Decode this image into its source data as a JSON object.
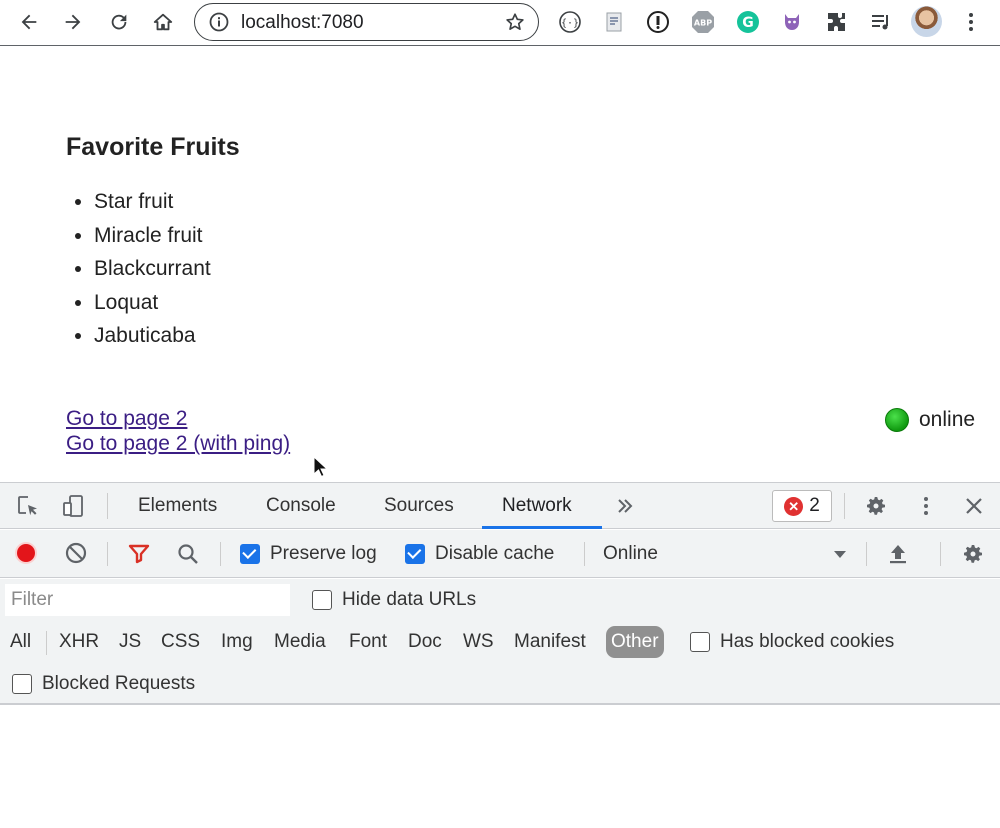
{
  "browser": {
    "url": "localhost:7080"
  },
  "page": {
    "title": "Favorite Fruits",
    "fruits": [
      "Star fruit",
      "Miracle fruit",
      "Blackcurrant",
      "Loquat",
      "Jabuticaba"
    ],
    "links": [
      "Go to page 2",
      "Go to page 2 (with ping)"
    ],
    "status": "online"
  },
  "devtools": {
    "tabs": [
      "Elements",
      "Console",
      "Sources",
      "Network"
    ],
    "active_tab": "Network",
    "error_count": "2",
    "network": {
      "preserve_log": "Preserve log",
      "disable_cache": "Disable cache",
      "throttling": "Online"
    },
    "filter": {
      "placeholder": "Filter",
      "hide_data_urls": "Hide data URLs",
      "types": [
        "All",
        "XHR",
        "JS",
        "CSS",
        "Img",
        "Media",
        "Font",
        "Doc",
        "WS",
        "Manifest",
        "Other"
      ],
      "active_type": "Other",
      "has_blocked_cookies": "Has blocked cookies",
      "blocked_requests": "Blocked Requests"
    }
  }
}
